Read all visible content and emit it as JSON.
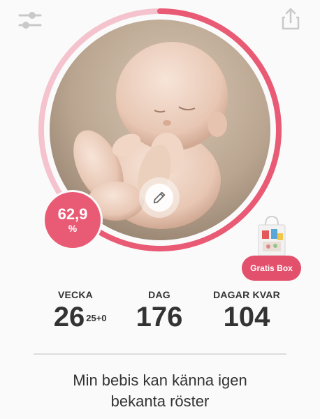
{
  "header": {
    "filter_icon": "sliders-icon",
    "share_icon": "share-icon"
  },
  "progress": {
    "value": "62,9",
    "unit": "%",
    "fraction": 0.629,
    "color_filled": "#e95a74",
    "color_empty": "#f4c3ce"
  },
  "photo": {
    "edit_icon": "pencil-icon"
  },
  "promo": {
    "button_label": "Gratis Box",
    "icon": "gift-box-icon"
  },
  "stats": {
    "week_label": "VECKA",
    "week_value": "26",
    "week_sup": "25+0",
    "day_label": "DAG",
    "day_value": "176",
    "days_left_label": "DAGAR KVAR",
    "days_left_value": "104"
  },
  "milestone": {
    "line1": "Min bebis kan känna igen",
    "line2": "bekanta röster"
  },
  "colors": {
    "accent": "#e95a74",
    "background": "#fafafa"
  }
}
